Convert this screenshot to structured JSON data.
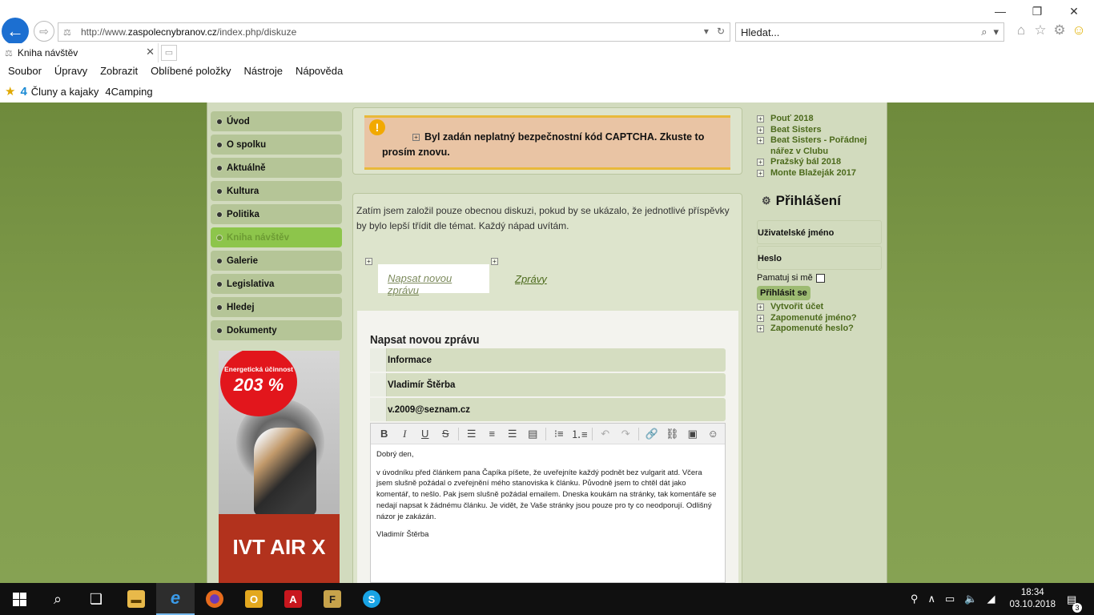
{
  "browser": {
    "url_prefix": "http://www.",
    "url_host": "zaspolecnybranov.cz",
    "url_path": "/index.php/diskuze",
    "search_placeholder": "Hledat...",
    "tab_title": "Kniha návštěv",
    "menu": [
      "Soubor",
      "Úpravy",
      "Zobrazit",
      "Oblíbené položky",
      "Nástroje",
      "Nápověda"
    ],
    "favorites": [
      "Čluny a kajaky",
      "4Camping"
    ]
  },
  "left_menu": [
    {
      "label": "Úvod",
      "active": false
    },
    {
      "label": "O spolku",
      "active": false
    },
    {
      "label": "Aktuálně",
      "active": false
    },
    {
      "label": "Kultura",
      "active": false
    },
    {
      "label": "Politika",
      "active": false
    },
    {
      "label": "Kniha návštěv",
      "active": true
    },
    {
      "label": "Galerie",
      "active": false
    },
    {
      "label": "Legislativa",
      "active": false
    },
    {
      "label": "Hledej",
      "active": false
    },
    {
      "label": "Dokumenty",
      "active": false
    }
  ],
  "ad": {
    "efficiency_label": "Energetická účinnost",
    "efficiency_value": "203 %",
    "product": "IVT AIR X"
  },
  "alert": {
    "message": "Byl zadán neplatný bezpečnostní kód CAPTCHA. Zkuste to prosím znovu."
  },
  "main": {
    "intro": "Zatím jsem založil pouze obecnou diskuzi, pokud by se ukázalo, že jednotlivé příspěvky by bylo lepší třídit dle témat. Každý nápad uvítám.",
    "tab_new": "Napsat novou zprávu",
    "tab_messages": "Zprávy",
    "form_title": "Napsat novou zprávu",
    "fields": [
      "Informace",
      "Vladimír Štěrba",
      "v.2009@seznam.cz"
    ],
    "editor_paragraphs": [
      "Dobrý den,",
      "v úvodníku před článkem pana Čapíka píšete, že uveřejníte každý podnět bez vulgarit atd. Včera jsem slušně požádal o zveřejnění mého stanoviska k článku. Původně jsem to chtěl dát jako komentář, to nešlo. Pak jsem slušně požádal emailem. Dneska koukám na stránky, tak komentáře se nedají napsat k žádnému článku. Je vidět, že Vaše stránky jsou pouze pro ty co neodporují. Odlišný názor je zakázán.",
      "Vladimír Štěrba"
    ]
  },
  "right": {
    "links": [
      "Pouť 2018",
      "Beat Sisters",
      "Beat Sisters - Pořádnej nářez v Clubu",
      "Pražský bál 2018",
      "Monte Blažeják 2017"
    ],
    "login_title": "Přihlášení",
    "username_label": "Uživatelské jméno",
    "password_label": "Heslo",
    "remember_label": "Pamatuj si mě",
    "login_button": "Přihlásit se",
    "account_links": [
      "Vytvořit účet",
      "Zapomenuté jméno?",
      "Zapomenuté heslo?"
    ]
  },
  "taskbar": {
    "time": "18:34",
    "date": "03.10.2018",
    "notification_count": "3"
  }
}
